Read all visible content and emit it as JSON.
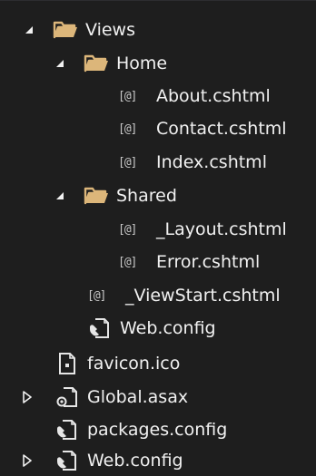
{
  "tree": {
    "items": [
      {
        "label": "Views",
        "icon": "folder-open-icon",
        "expander": "expanded",
        "level": 1
      },
      {
        "label": "Home",
        "icon": "folder-open-icon",
        "expander": "expanded",
        "level": 2
      },
      {
        "label": "About.cshtml",
        "icon": "razor-file-icon",
        "expander": "none",
        "level": 3
      },
      {
        "label": "Contact.cshtml",
        "icon": "razor-file-icon",
        "expander": "none",
        "level": 3
      },
      {
        "label": "Index.cshtml",
        "icon": "razor-file-icon",
        "expander": "none",
        "level": 3
      },
      {
        "label": "Shared",
        "icon": "folder-open-icon",
        "expander": "expanded",
        "level": 2
      },
      {
        "label": "_Layout.cshtml",
        "icon": "razor-file-icon",
        "expander": "none",
        "level": 3
      },
      {
        "label": "Error.cshtml",
        "icon": "razor-file-icon",
        "expander": "none",
        "level": 3
      },
      {
        "label": "_ViewStart.cshtml",
        "icon": "razor-file-icon",
        "expander": "none",
        "level": 2
      },
      {
        "label": "Web.config",
        "icon": "config-file-icon",
        "expander": "none",
        "level": 2
      },
      {
        "label": "favicon.ico",
        "icon": "image-file-icon",
        "expander": "none",
        "level": 1
      },
      {
        "label": "Global.asax",
        "icon": "asax-file-icon",
        "expander": "collapsed",
        "level": 1
      },
      {
        "label": "packages.config",
        "icon": "config-file-icon",
        "expander": "none",
        "level": 1
      },
      {
        "label": "Web.config",
        "icon": "config-file-icon",
        "expander": "collapsed",
        "level": 1
      }
    ],
    "razor_glyph": "[@]"
  },
  "colors": {
    "background": "#1e1e1e",
    "text": "#f1f1f1",
    "folder": "#dcb67a",
    "icon": "#c8c8c8"
  }
}
